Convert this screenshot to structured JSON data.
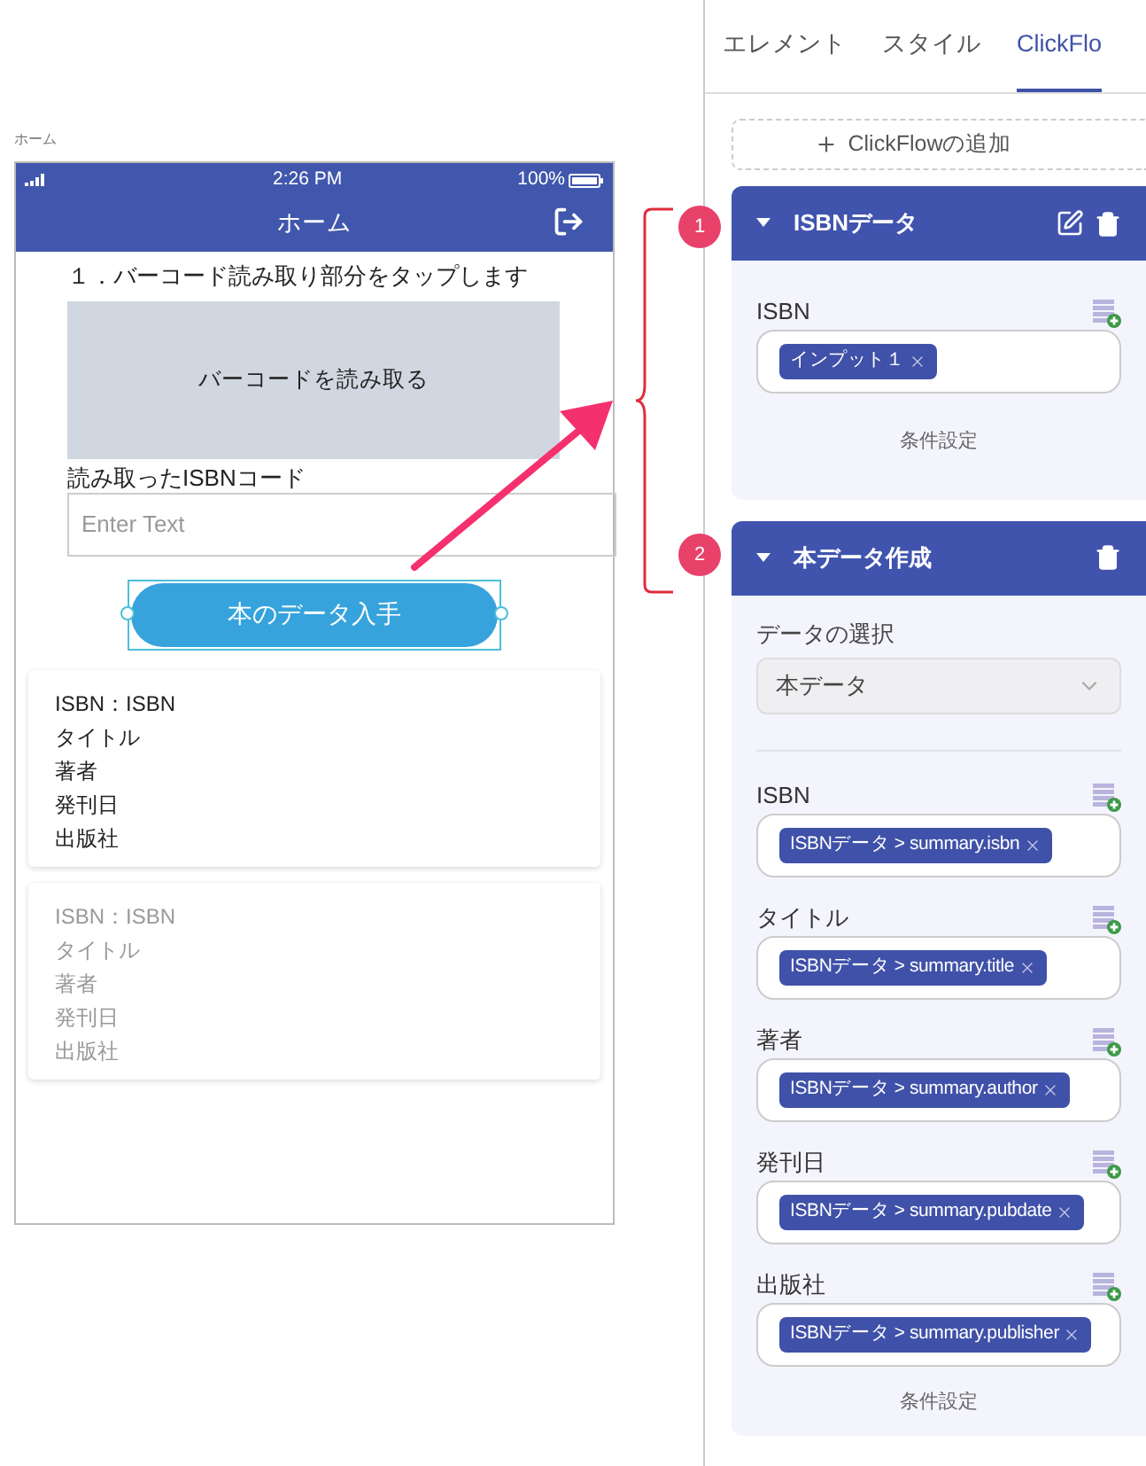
{
  "canvas": {
    "screen_label": "ホーム"
  },
  "phone": {
    "status_bar": {
      "time": "2:26 PM",
      "battery": "100%"
    },
    "header_title": "ホーム",
    "instruction": "１．バーコード読み取り部分をタップします",
    "scan_area_label": "バーコードを読み取る",
    "input": {
      "label": "読み取ったISBNコード",
      "placeholder": "Enter Text"
    },
    "button": {
      "label": "本のデータ入手",
      "selected": true
    },
    "cards": [
      {
        "lines": [
          "ISBN：ISBN",
          "タイトル",
          "著者",
          "発刊日",
          "出版社"
        ],
        "disabled": false
      },
      {
        "lines": [
          "ISBN：ISBN",
          "タイトル",
          "著者",
          "発刊日",
          "出版社"
        ],
        "disabled": true
      }
    ]
  },
  "annotations": {
    "markers": [
      "1",
      "2"
    ]
  },
  "panel": {
    "tabs": [
      {
        "label": "エレメント",
        "selected": false
      },
      {
        "label": "スタイル",
        "selected": false
      },
      {
        "label": "ClickFlo",
        "selected": true
      }
    ],
    "add_button": "ClickFlowの追加",
    "flows": [
      {
        "title": "ISBNデータ",
        "editable": true,
        "kind": "api",
        "fields": [
          {
            "label": "ISBN",
            "tags": [
              "インプット１"
            ]
          }
        ],
        "footer": "条件設定"
      },
      {
        "title": "本データ作成",
        "editable": false,
        "kind": "create",
        "data_select": {
          "label": "データの選択",
          "value": "本データ"
        },
        "fields": [
          {
            "label": "ISBN",
            "tags": [
              "ISBNデータ > summary.isbn"
            ]
          },
          {
            "label": "タイトル",
            "tags": [
              "ISBNデータ > summary.title"
            ]
          },
          {
            "label": "著者",
            "tags": [
              "ISBNデータ > summary.author"
            ]
          },
          {
            "label": "発刊日",
            "tags": [
              "ISBNデータ > summary.pubdate"
            ]
          },
          {
            "label": "出版社",
            "tags": [
              "ISBNデータ > summary.publisher"
            ]
          }
        ],
        "footer": "条件設定"
      }
    ]
  }
}
